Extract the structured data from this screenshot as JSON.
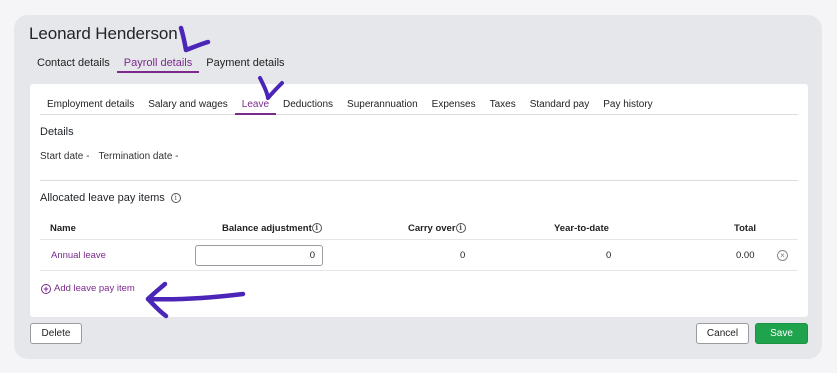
{
  "page": {
    "title": "Leonard Henderson"
  },
  "top_tabs": [
    {
      "label": "Contact details",
      "active": false
    },
    {
      "label": "Payroll details",
      "active": true
    },
    {
      "label": "Payment details",
      "active": false
    }
  ],
  "sub_tabs": [
    {
      "label": "Employment details",
      "active": false
    },
    {
      "label": "Salary and wages",
      "active": false
    },
    {
      "label": "Leave",
      "active": true
    },
    {
      "label": "Deductions",
      "active": false
    },
    {
      "label": "Superannuation",
      "active": false
    },
    {
      "label": "Expenses",
      "active": false
    },
    {
      "label": "Taxes",
      "active": false
    },
    {
      "label": "Standard pay",
      "active": false
    },
    {
      "label": "Pay history",
      "active": false
    }
  ],
  "details": {
    "heading": "Details",
    "start_date": "Start date -",
    "termination_date": "Termination date -"
  },
  "leave_items": {
    "heading": "Allocated leave pay items",
    "columns": {
      "name": "Name",
      "balance_adjustment": "Balance adjustment",
      "carry_over": "Carry over",
      "year_to_date": "Year-to-date",
      "total": "Total"
    },
    "rows": [
      {
        "name": "Annual leave",
        "balance_adjustment": "0",
        "carry_over": "0",
        "year_to_date": "0",
        "total": "0.00"
      }
    ],
    "add_label": "Add leave pay item"
  },
  "footer": {
    "delete_label": "Delete",
    "cancel_label": "Cancel",
    "save_label": "Save"
  },
  "colors": {
    "accent": "#7b2a8c",
    "primary_button": "#1fa34d",
    "annotation": "#4a25b8"
  },
  "icons": {
    "info": "info-icon",
    "remove": "remove-circle-icon",
    "add": "plus-circle-icon"
  }
}
